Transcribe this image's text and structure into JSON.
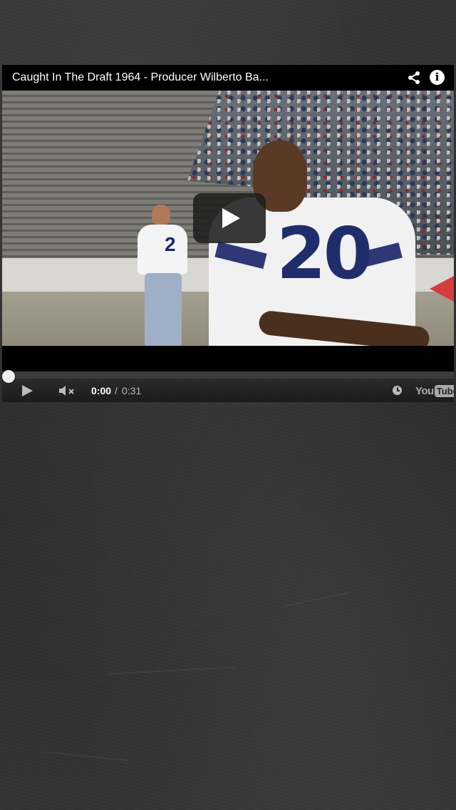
{
  "player": {
    "title": "Caught In The Draft 1964 - Producer Wilberto Ba...",
    "jersey_number_back": "2",
    "jersey_number_front": "20",
    "progress_fraction": 0.0,
    "time_current": "0:00",
    "time_separator": "/",
    "time_total": "0:31",
    "logo_you": "You",
    "logo_tube": "Tube"
  },
  "icons": {
    "share": "share-icon",
    "info": "info-icon",
    "play": "play-icon",
    "volume": "volume-muted-icon",
    "watch_later": "clock-icon",
    "youtube": "youtube-logo"
  },
  "colors": {
    "progress": "#cc181e",
    "background": "#2f2f2f"
  }
}
